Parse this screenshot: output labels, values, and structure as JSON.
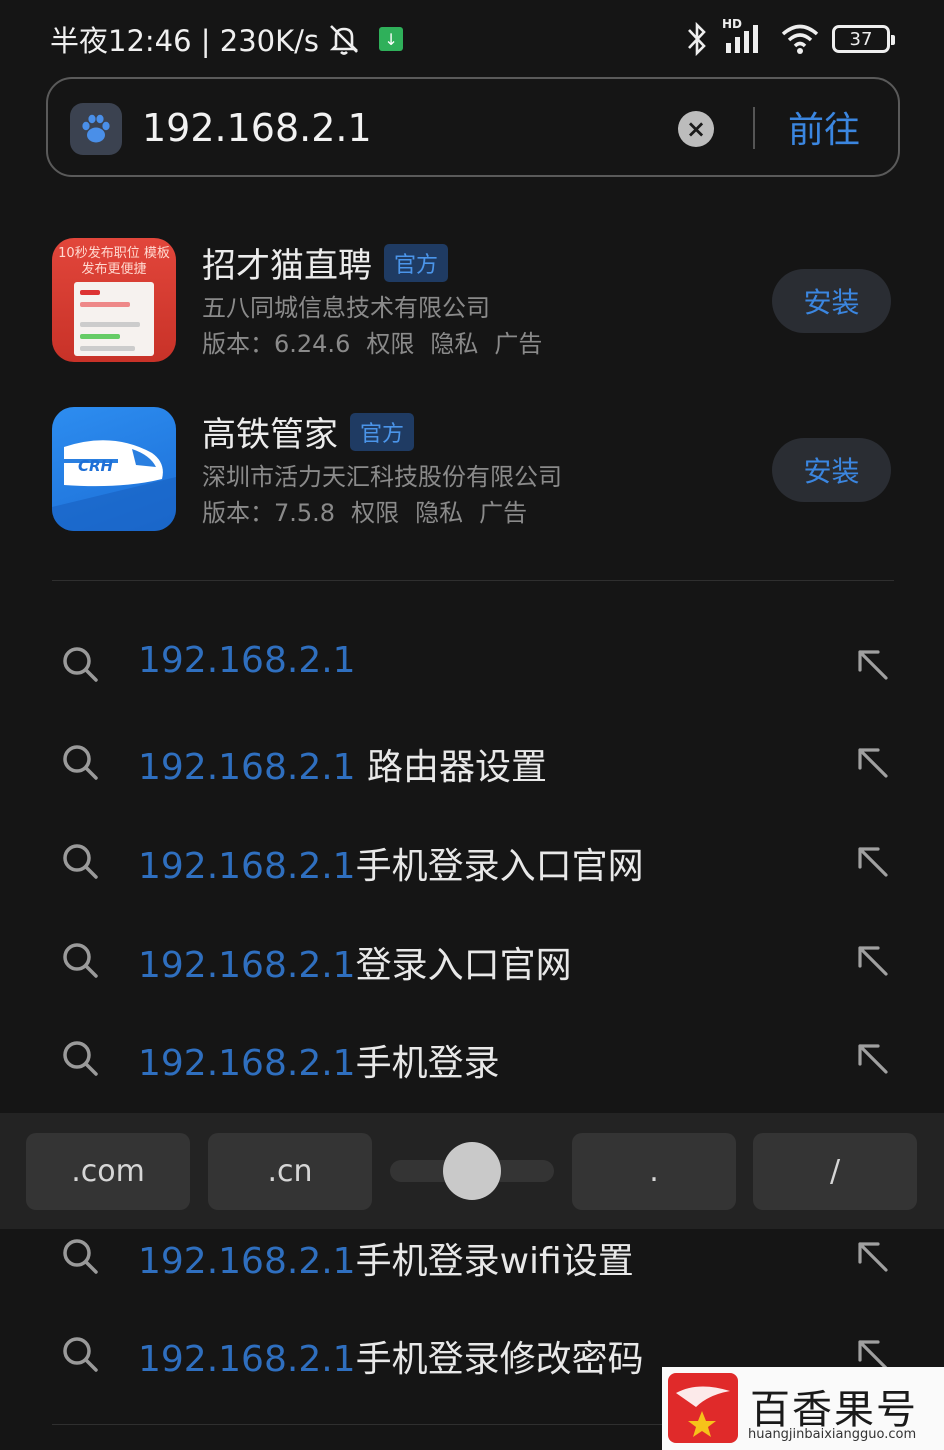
{
  "status_bar": {
    "time_speed": "半夜12:46 | 230K/s",
    "battery": "37",
    "network_label": "HD"
  },
  "search": {
    "url": "192.168.2.1",
    "go_label": "前往"
  },
  "apps": [
    {
      "name": "招才猫直聘",
      "badge": "官方",
      "company": "五八同城信息技术有限公司",
      "version": "版本：6.24.6",
      "perm": "权限",
      "privacy": "隐私",
      "ad": "广告",
      "install_label": "安装",
      "icon_text": "10秒发布职位 模板发布更便捷"
    },
    {
      "name": "高铁管家",
      "badge": "官方",
      "company": "深圳市活力天汇科技股份有限公司",
      "version": "版本：7.5.8",
      "perm": "权限",
      "privacy": "隐私",
      "ad": "广告",
      "install_label": "安装",
      "icon_text": "CRH"
    }
  ],
  "suggestions": [
    {
      "query": "192.168.2.1",
      "rest": ""
    },
    {
      "query": "192.168.2.1",
      "rest": " 路由器设置"
    },
    {
      "query": "192.168.2.1",
      "rest": "手机登录入口官网"
    },
    {
      "query": "192.168.2.1",
      "rest": "登录入口官网"
    },
    {
      "query": "192.168.2.1",
      "rest": "手机登录"
    },
    {
      "query": "192.168.2.1",
      "rest": "手机登录wifi设置"
    },
    {
      "query": "192.168.2.1",
      "rest": "手机登录修改密码"
    }
  ],
  "keyboard_bar": {
    "key_com": ".com",
    "key_cn": ".cn",
    "key_dot": ".",
    "key_slash": "/"
  },
  "watermark": {
    "name": "百香果号",
    "url": "huangjinbaixiangguo.com"
  },
  "colors": {
    "accent": "#3b86e0",
    "background": "#151515"
  }
}
